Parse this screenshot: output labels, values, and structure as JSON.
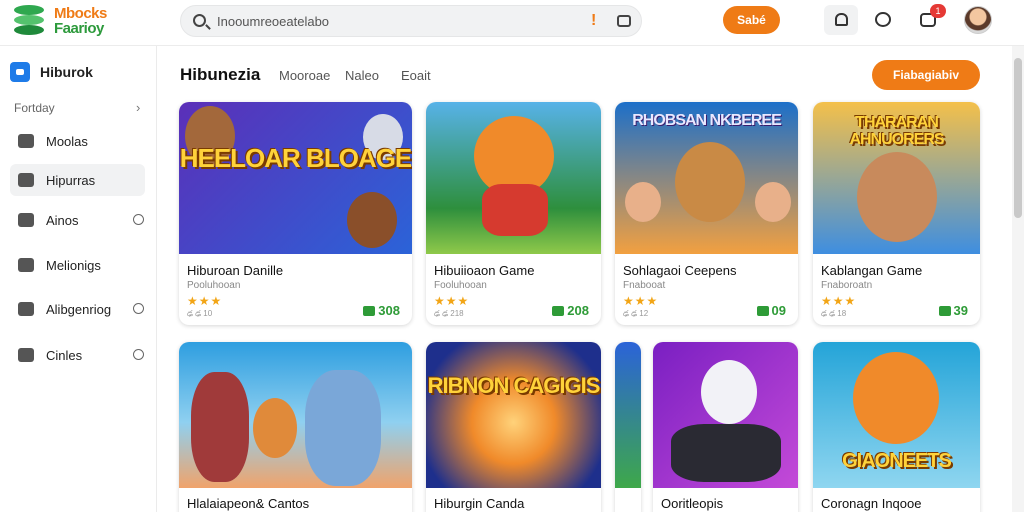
{
  "header": {
    "logo_line1": "Mbocks",
    "logo_line2": "Faarioy",
    "search_placeholder": "Inooumreoeatelabo",
    "action_button": "Sabé",
    "notification_count": "1"
  },
  "sidebar": {
    "top_label": "Hiburok",
    "section_label": "Fortday",
    "items": [
      {
        "label": "Moolas",
        "icon": "book-icon"
      },
      {
        "label": "Hipurras",
        "icon": "folder-icon"
      },
      {
        "label": "Ainos",
        "icon": "grid-icon"
      },
      {
        "label": "Melionigs",
        "icon": "brush-icon"
      },
      {
        "label": "Alibgenriog",
        "icon": "calendar-icon"
      },
      {
        "label": "Cinles",
        "icon": "folder-icon"
      }
    ]
  },
  "main": {
    "title": "Hibunezia",
    "tabs": [
      "Mooroae",
      "Naleo",
      "Eoait"
    ],
    "action_button": "Fiabagiabiv"
  },
  "cards": [
    {
      "art_title": "HEELOAR BLOAGE",
      "name": "Hiburoan Danille",
      "sub": "Pooluhooan",
      "stars": "★★★",
      "tiny": "ఢ ఢ 10",
      "price": "308",
      "colors": [
        "#5b2fb8",
        "#2b63d8"
      ]
    },
    {
      "art_title": "",
      "name": "Hibuiioaon Game",
      "sub": "Fooluhooan",
      "stars": "★★★",
      "tiny": "ఢ ఢ 218",
      "price": "208",
      "colors": [
        "#2e8f3d",
        "#8fc94a"
      ]
    },
    {
      "art_title": "RHOBSAN NKBEREE",
      "name": "Sohlagaoi Ceepens",
      "sub": "Fnabooat",
      "stars": "★★★",
      "tiny": "ఢ ఢ 12",
      "price": "09",
      "colors": [
        "#1c6fc9",
        "#f2a040"
      ]
    },
    {
      "art_title": "THARARAN AHNUORERS",
      "name": "Kablangan Game",
      "sub": "Fnaboroatn",
      "stars": "★★★",
      "tiny": "ఢ ఢ 18",
      "price": "39",
      "colors": [
        "#f4c04a",
        "#3e8ee0"
      ]
    },
    {
      "art_title": "",
      "name": "Hlalaiapeon& Cantos",
      "colors": [
        "#2e9ee0",
        "#f0a36b"
      ]
    },
    {
      "art_title": "RIBNON CAGIGIS",
      "name": "Hiburgin Canda",
      "colors": [
        "#1e2f8c",
        "#f08a2a"
      ]
    },
    {
      "art_title": "",
      "name": "Ooritleopis",
      "colors": [
        "#7a1fc2",
        "#c44ad8"
      ]
    },
    {
      "art_title": "GIAONEETS",
      "name": "Coronagn Inqooe",
      "colors": [
        "#24a4d8",
        "#f3c13a"
      ]
    }
  ]
}
